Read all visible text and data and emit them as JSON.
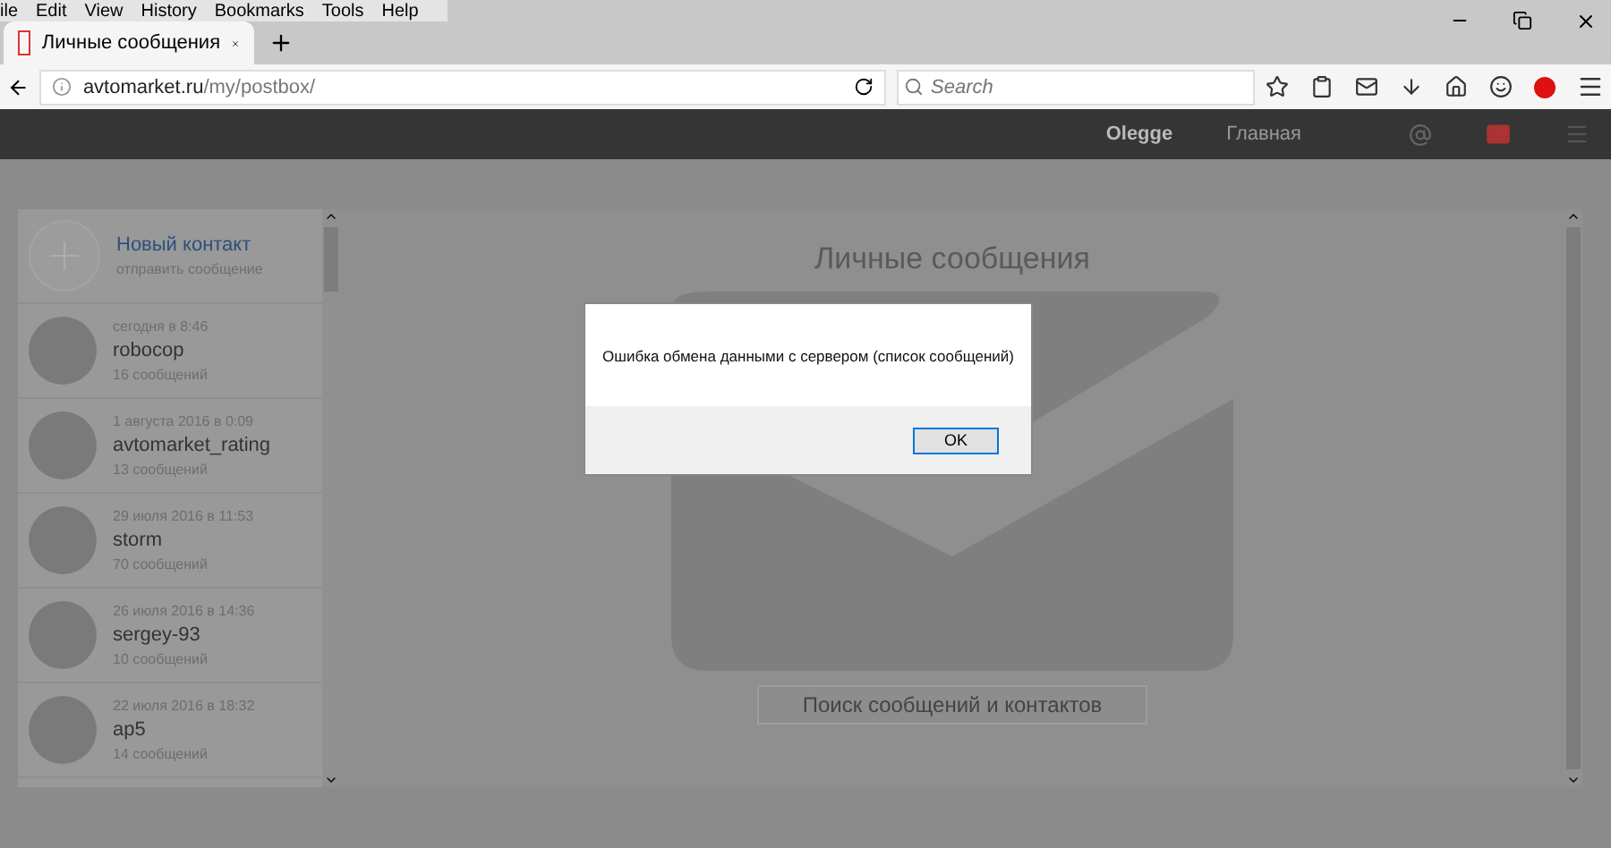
{
  "menu_bar": [
    "ile",
    "Edit",
    "View",
    "History",
    "Bookmarks",
    "Tools",
    "Help"
  ],
  "tabs": [
    {
      "title": "Личные сообщения",
      "selected": true
    }
  ],
  "address_bar": {
    "domain": "avtomarket.ru",
    "path": "/my/postbox/"
  },
  "search": {
    "placeholder": "Search"
  },
  "site_header": {
    "user": "Olegge",
    "home": "Главная"
  },
  "new_contact": {
    "title": "Новый контакт",
    "subtitle": "отправить сообщение"
  },
  "contacts": [
    {
      "date": "сегодня в 8:46",
      "name": "robocop",
      "count": "16 сообщений"
    },
    {
      "date": "1 августа 2016 в 0:09",
      "name": "avtomarket_rating",
      "count": "13 сообщений"
    },
    {
      "date": "29 июля 2016 в 11:53",
      "name": "storm",
      "count": "70 сообщений"
    },
    {
      "date": "26 июля 2016 в 14:36",
      "name": "sergey-93",
      "count": "10 сообщений"
    },
    {
      "date": "22 июля 2016 в 18:32",
      "name": "ap5",
      "count": "14 сообщений"
    }
  ],
  "main": {
    "title": "Личные сообщения",
    "search_button": "Поиск сообщений и контактов"
  },
  "dialog": {
    "message": "Ошибка обмена данными с сервером (список сообщений)",
    "button": "OK"
  }
}
